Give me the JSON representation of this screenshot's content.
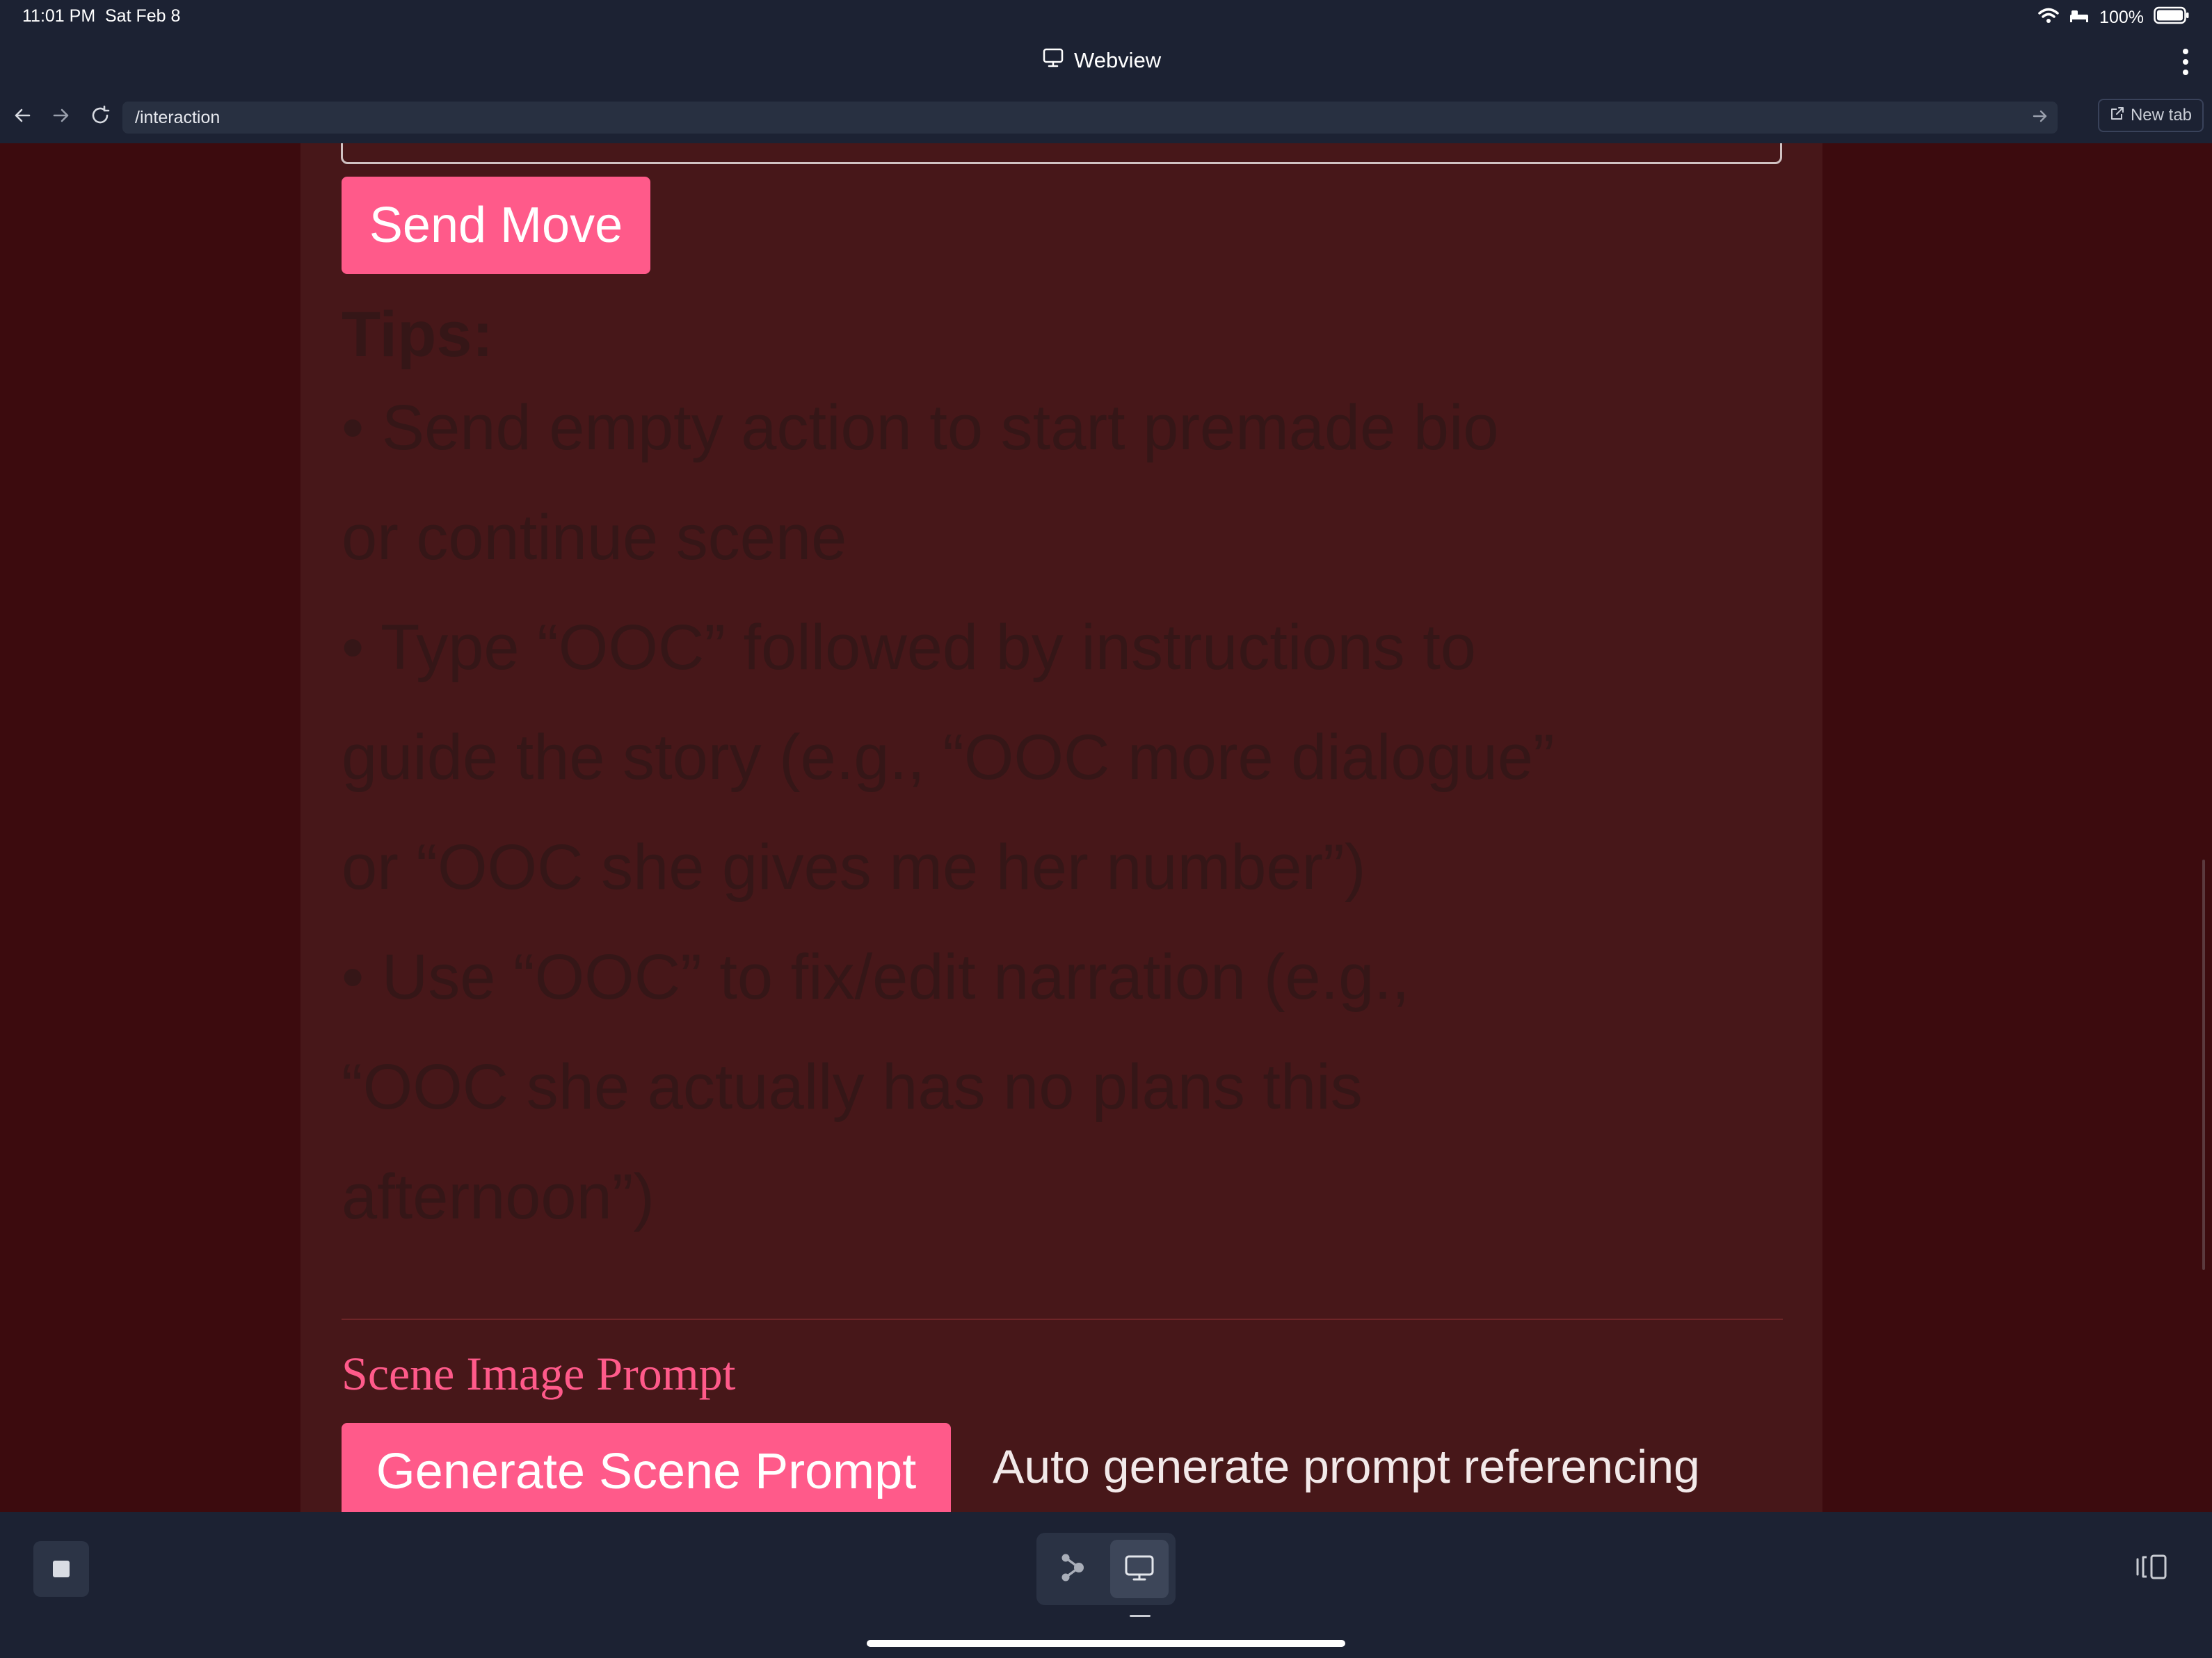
{
  "status_bar": {
    "time": "11:01 PM",
    "date": "Sat Feb 8",
    "battery": "100%",
    "icons": [
      "wifi-icon",
      "bed-icon",
      "battery-icon"
    ]
  },
  "title_bar": {
    "title": "Webview",
    "icon": "monitor-icon",
    "menu_icon": "more-vertical-icon"
  },
  "nav": {
    "url": "/interaction",
    "new_tab_label": "New tab",
    "icons": [
      "back-arrow-icon",
      "forward-arrow-icon",
      "reload-icon",
      "go-arrow-icon",
      "external-link-icon"
    ]
  },
  "page": {
    "send_button": "Send Move",
    "tips": {
      "heading": "Tips:",
      "lines": [
        "• Send empty action to start premade bio",
        "or continue scene",
        "• Type “OOC” followed by instructions to",
        "guide the story (e.g., “OOC more dialogue”",
        "or “OOC she gives me her number”)",
        "• Use “OOC” to fix/edit narration (e.g.,",
        "“OOC she actually has no plans this",
        "afternoon”)"
      ]
    },
    "scene_heading": "Scene Image Prompt",
    "generate_button": "Generate Scene Prompt",
    "auto_text": "Auto generate prompt referencing"
  },
  "bottom_bar": {
    "stop_icon": "stop-icon",
    "flow_icon": "flow-icon",
    "webview_icon": "monitor-icon",
    "split_icon": "split-view-icon"
  },
  "colors": {
    "background": "#3c0b0e",
    "card": "#471719",
    "accent": "#ff5a8a",
    "chrome": "#1c2233",
    "tips_text": "#351617"
  }
}
